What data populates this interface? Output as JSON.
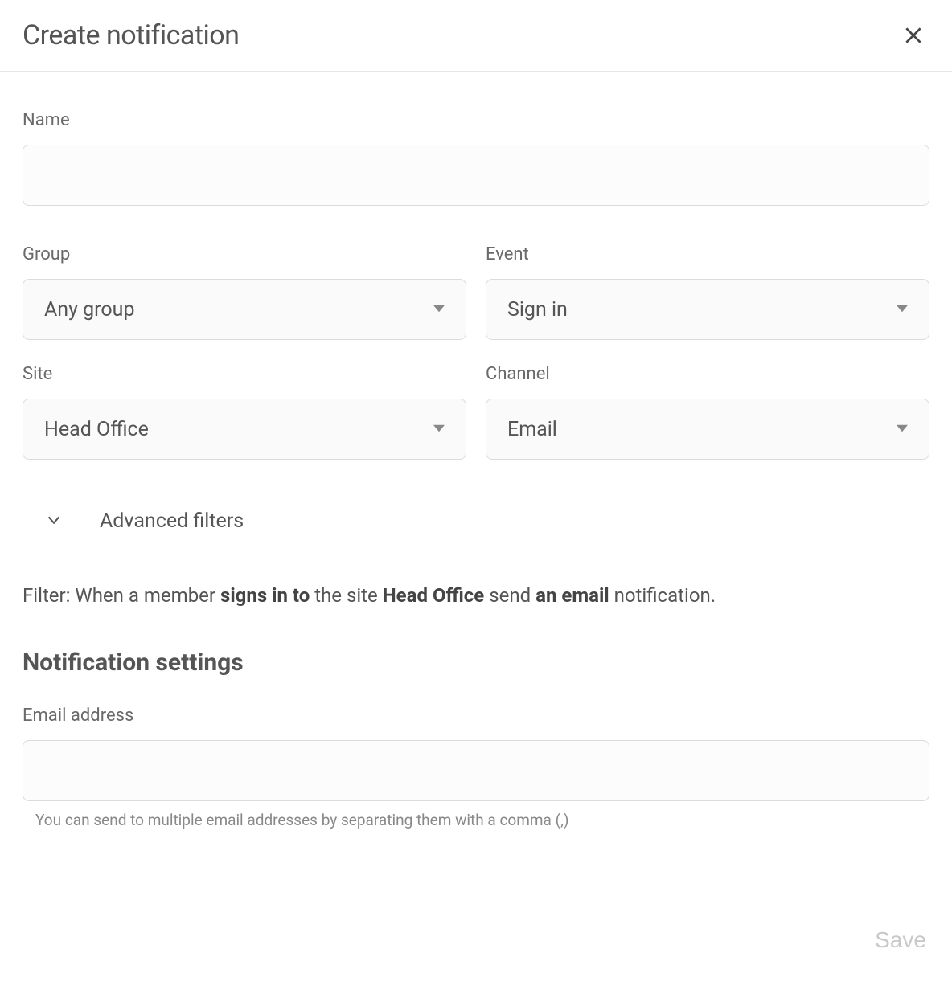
{
  "dialog": {
    "title": "Create notification"
  },
  "fields": {
    "name": {
      "label": "Name",
      "value": ""
    },
    "group": {
      "label": "Group",
      "value": "Any group"
    },
    "event": {
      "label": "Event",
      "value": "Sign in"
    },
    "site": {
      "label": "Site",
      "value": "Head Office"
    },
    "channel": {
      "label": "Channel",
      "value": "Email"
    }
  },
  "advanced": {
    "label": "Advanced filters"
  },
  "filter_summary": {
    "prefix": "Filter: When a member ",
    "bold1": "signs in to",
    "mid1": " the site ",
    "bold2": "Head Office",
    "mid2": " send ",
    "bold3": "an email",
    "suffix": " notification."
  },
  "settings": {
    "heading": "Notification settings",
    "email": {
      "label": "Email address",
      "value": "",
      "helper": "You can send to multiple email addresses by separating them with a comma (,)"
    }
  },
  "actions": {
    "save": "Save"
  }
}
